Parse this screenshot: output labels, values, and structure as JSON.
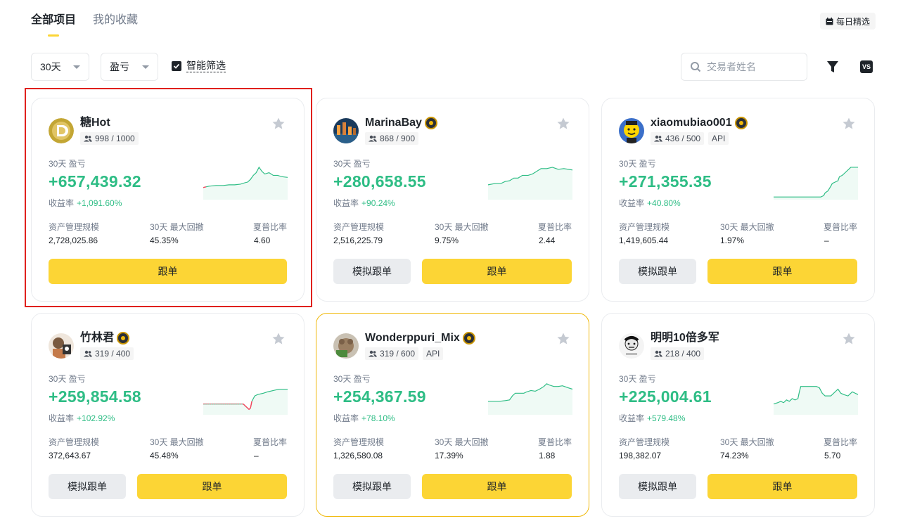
{
  "tabs": [
    {
      "label": "全部项目"
    },
    {
      "label": "我的收藏"
    }
  ],
  "daily_pick": "每日精选",
  "filters": {
    "period": "30天",
    "sort": "盈亏",
    "smart_filter": "智能筛选",
    "search_placeholder": "交易者姓名"
  },
  "vs_label": "VS",
  "labels": {
    "pnl": "30天 盈亏",
    "roi": "收益率",
    "aum": "资产管理规模",
    "mdd": "30天 最大回撤",
    "sharpe": "夏普比率",
    "mock_copy": "模拟跟单",
    "copy": "跟单"
  },
  "colors": {
    "accent": "#fcd535",
    "profit": "#2ebd85",
    "loss": "#f6465d",
    "selected_outline": "#e0201d"
  },
  "cards": [
    {
      "name": "糖Hot",
      "followers": "998 / 1000",
      "api": "",
      "pnl": "+657,439.32",
      "roi": "+1,091.60%",
      "aum": "2,728,025.86",
      "mdd": "45.35%",
      "sharpe": "4.60",
      "mock": false,
      "verified": false,
      "avatar": "doge-avatar-icon",
      "selected": true
    },
    {
      "name": "MarinaBay",
      "followers": "868 / 900",
      "api": "",
      "pnl": "+280,658.55",
      "roi": "+90.24%",
      "aum": "2,516,225.79",
      "mdd": "9.75%",
      "sharpe": "2.44",
      "mock": true,
      "verified": true,
      "avatar": "city-avatar-icon"
    },
    {
      "name": "xiaomubiao001",
      "followers": "436 / 500",
      "api": "API",
      "pnl": "+271,355.35",
      "roi": "+40.80%",
      "aum": "1,419,605.44",
      "mdd": "1.97%",
      "sharpe": "–",
      "mock": true,
      "verified": true,
      "avatar": "smiley-avatar-icon"
    },
    {
      "name": "竹林君",
      "followers": "319 / 400",
      "api": "",
      "pnl": "+259,854.58",
      "roi": "+102.92%",
      "aum": "372,643.67",
      "mdd": "45.48%",
      "sharpe": "–",
      "mock": true,
      "verified": true,
      "avatar": "portrait-avatar-icon"
    },
    {
      "name": "Wonderppuri_Mix",
      "followers": "319 / 600",
      "api": "API",
      "pnl": "+254,367.59",
      "roi": "+78.10%",
      "aum": "1,326,580.08",
      "mdd": "17.39%",
      "sharpe": "1.88",
      "mock": true,
      "verified": true,
      "avatar": "dog-avatar-icon",
      "highlight": true
    },
    {
      "name": "明明10倍多军",
      "followers": "218 / 400",
      "api": "",
      "pnl": "+225,004.61",
      "roi": "+579.48%",
      "aum": "198,382.07",
      "mdd": "74.23%",
      "sharpe": "5.70",
      "mock": true,
      "verified": false,
      "avatar": "meme-avatar-icon"
    }
  ]
}
